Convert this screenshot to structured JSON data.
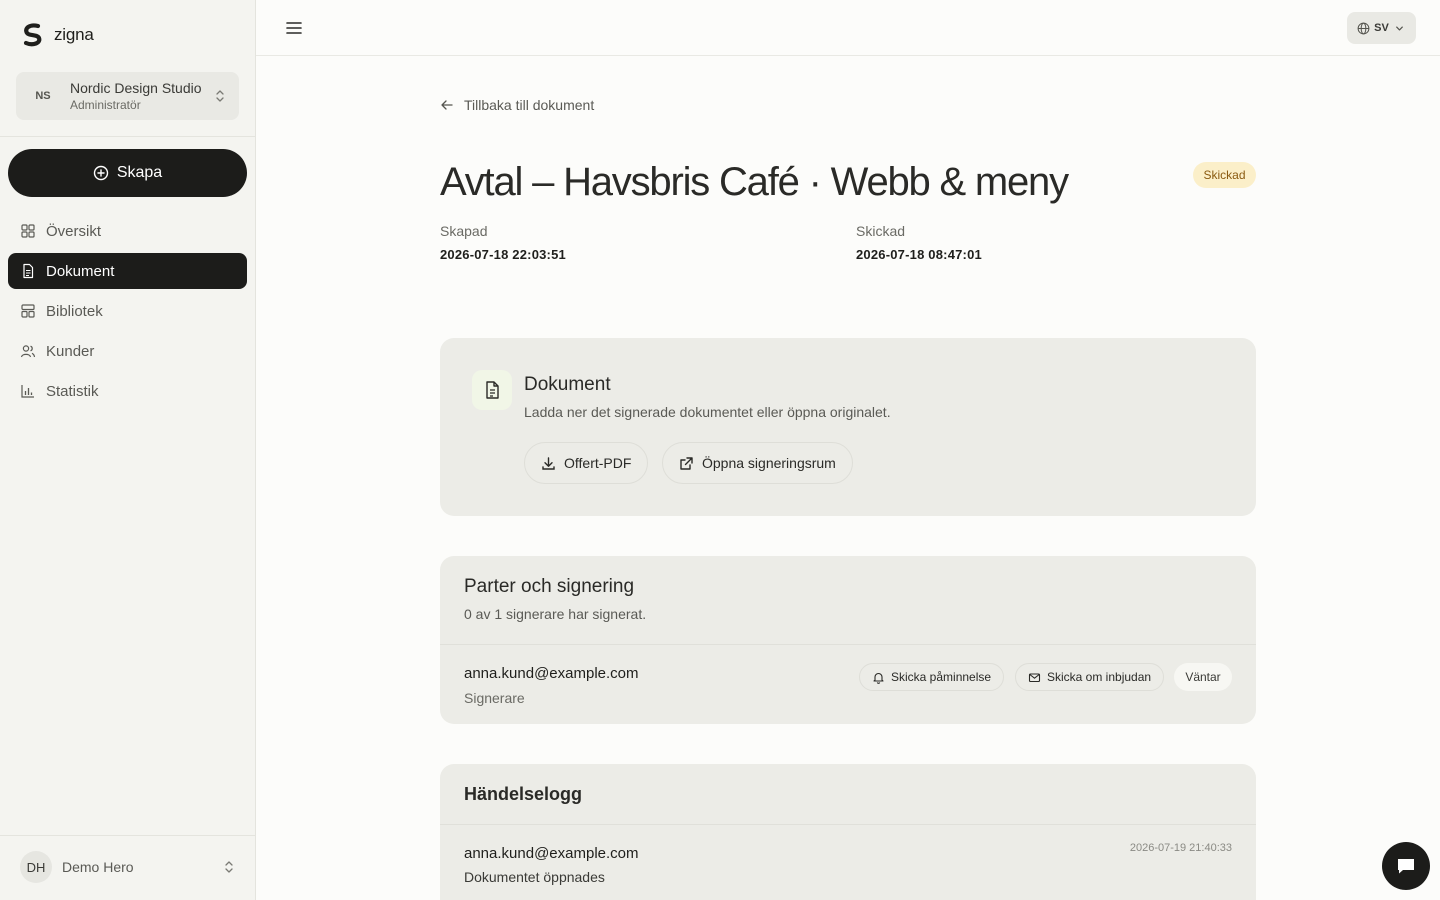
{
  "brand": {
    "name": "zigna"
  },
  "org": {
    "initials": "NS",
    "name": "Nordic Design Studio",
    "role": "Administratör"
  },
  "create_button": {
    "label": "Skapa"
  },
  "nav": [
    {
      "label": "Översikt",
      "icon": "grid-icon",
      "active": false
    },
    {
      "label": "Dokument",
      "icon": "document-icon",
      "active": true
    },
    {
      "label": "Bibliotek",
      "icon": "library-icon",
      "active": false
    },
    {
      "label": "Kunder",
      "icon": "users-icon",
      "active": false
    },
    {
      "label": "Statistik",
      "icon": "bar-chart-icon",
      "active": false
    }
  ],
  "user": {
    "initials": "DH",
    "name": "Demo Hero"
  },
  "topbar": {
    "language": "SV"
  },
  "page": {
    "back_link": "Tillbaka till dokument",
    "title": "Avtal – Havsbris Café · Webb & meny",
    "status_badge": "Skickad",
    "created_label": "Skapad",
    "created_value": "2026-07-18 22:03:51",
    "sent_label": "Skickad",
    "sent_value": "2026-07-18 08:47:01"
  },
  "document_card": {
    "title": "Dokument",
    "description": "Ladda ner det signerade dokumentet eller öppna originalet.",
    "pdf_button": "Offert-PDF",
    "open_button": "Öppna signeringsrum"
  },
  "parties_card": {
    "title": "Parter och signering",
    "subtitle": "0 av 1 signerare har signerat.",
    "signer": {
      "email": "anna.kund@example.com",
      "role": "Signerare",
      "remind_button": "Skicka påminnelse",
      "resend_button": "Skicka om inbjudan",
      "status": "Väntar"
    }
  },
  "log_card": {
    "title": "Händelselogg",
    "entries": [
      {
        "email": "anna.kund@example.com",
        "event": "Dokumentet öppnades",
        "time": "2026-07-19 21:40:33"
      }
    ]
  },
  "colors": {
    "accent": "#1c1c1a",
    "badge_bg": "#fbefc9",
    "badge_text": "#8a5a10"
  }
}
